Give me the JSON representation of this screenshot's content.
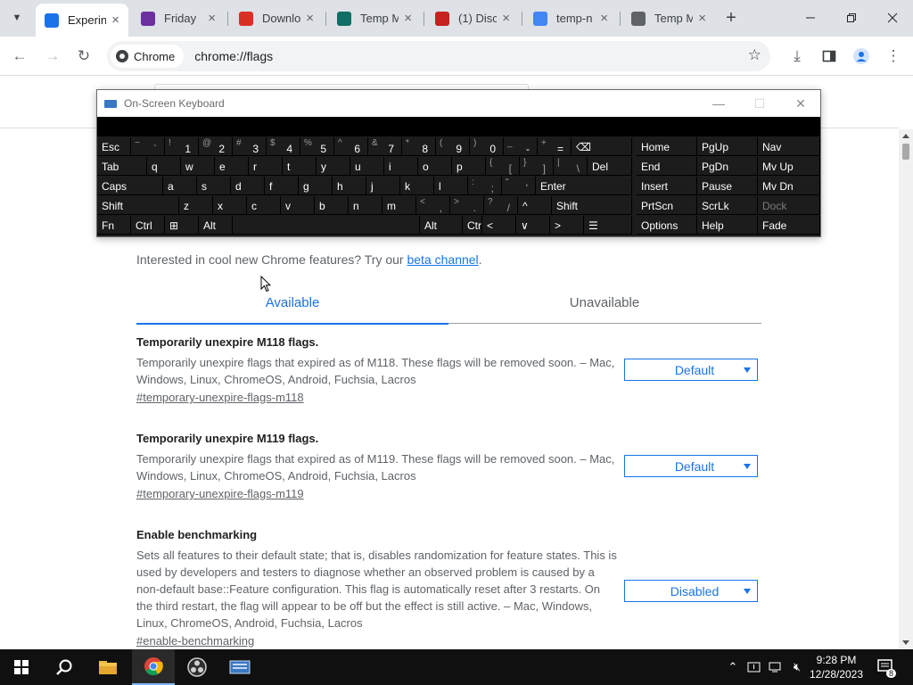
{
  "browser": {
    "tabs": [
      {
        "title": "Experin",
        "favicon_color": "#1a73e8",
        "active": true
      },
      {
        "title": "Friday",
        "favicon_color": "#6b2fa0",
        "active": false
      },
      {
        "title": "Downlo",
        "favicon_color": "#d93025",
        "active": false
      },
      {
        "title": "Temp M",
        "favicon_color": "#0f6e65",
        "active": false
      },
      {
        "title": "(1) Disc",
        "favicon_color": "#c5221f",
        "active": false
      },
      {
        "title": "temp-n",
        "favicon_color": "#4285f4",
        "active": false
      },
      {
        "title": "Temp M",
        "favicon_color": "#5f6368",
        "active": false
      }
    ],
    "chip_label": "Chrome",
    "url": "chrome://flags"
  },
  "page": {
    "promo_text": "Interested in cool new Chrome features? Try our ",
    "promo_link": "beta channel",
    "promo_end": ".",
    "tab_available": "Available",
    "tab_unavailable": "Unavailable",
    "flags": [
      {
        "title": "Temporarily unexpire M118 flags.",
        "description": "Temporarily unexpire flags that expired as of M118. These flags will be removed soon. – Mac, Windows, Linux, ChromeOS, Android, Fuchsia, Lacros",
        "permalink": "#temporary-unexpire-flags-m118",
        "value": "Default"
      },
      {
        "title": "Temporarily unexpire M119 flags.",
        "description": "Temporarily unexpire flags that expired as of M119. These flags will be removed soon. – Mac, Windows, Linux, ChromeOS, Android, Fuchsia, Lacros",
        "permalink": "#temporary-unexpire-flags-m119",
        "value": "Default"
      },
      {
        "title": "Enable benchmarking",
        "description": "Sets all features to their default state; that is, disables randomization for feature states. This is used by developers and testers to diagnose whether an observed problem is caused by a non-default base::Feature configuration. This flag is automatically reset after 3 restarts. On the third restart, the flag will appear to be off but the effect is still active. – Mac, Windows, Linux, ChromeOS, Android, Fuchsia, Lacros",
        "permalink": "#enable-benchmarking",
        "value": "Disabled"
      }
    ]
  },
  "osk": {
    "title": "On-Screen Keyboard",
    "row1": [
      {
        "lg": "Esc"
      },
      {
        "sm": "~",
        "lg": "`"
      },
      {
        "sm": "!",
        "lg": "1"
      },
      {
        "sm": "@",
        "lg": "2"
      },
      {
        "sm": "#",
        "lg": "3"
      },
      {
        "sm": "$",
        "lg": "4"
      },
      {
        "sm": "%",
        "lg": "5"
      },
      {
        "sm": "^",
        "lg": "6"
      },
      {
        "sm": "&",
        "lg": "7"
      },
      {
        "sm": "*",
        "lg": "8"
      },
      {
        "sm": "(",
        "lg": "9"
      },
      {
        "sm": ")",
        "lg": "0"
      },
      {
        "sm": "_",
        "lg": "-"
      },
      {
        "sm": "+",
        "lg": "="
      },
      {
        "lg": "⌫"
      }
    ],
    "row2": [
      {
        "lg": "Tab"
      },
      {
        "lg": "q"
      },
      {
        "lg": "w"
      },
      {
        "lg": "e"
      },
      {
        "lg": "r"
      },
      {
        "lg": "t"
      },
      {
        "lg": "y"
      },
      {
        "lg": "u"
      },
      {
        "lg": "i"
      },
      {
        "lg": "o"
      },
      {
        "lg": "p"
      },
      {
        "sm": "{",
        "lg": "["
      },
      {
        "sm": "}",
        "lg": "]"
      },
      {
        "sm": "|",
        "lg": "\\"
      },
      {
        "lg": "Del"
      }
    ],
    "row3": [
      {
        "lg": "Caps"
      },
      {
        "lg": "a"
      },
      {
        "lg": "s"
      },
      {
        "lg": "d"
      },
      {
        "lg": "f"
      },
      {
        "lg": "g"
      },
      {
        "lg": "h"
      },
      {
        "lg": "j"
      },
      {
        "lg": "k"
      },
      {
        "lg": "l"
      },
      {
        "sm": ":",
        "lg": ";"
      },
      {
        "sm": "\"",
        "lg": "'"
      },
      {
        "lg": "Enter"
      }
    ],
    "row4": [
      {
        "lg": "Shift"
      },
      {
        "lg": "z"
      },
      {
        "lg": "x"
      },
      {
        "lg": "c"
      },
      {
        "lg": "v"
      },
      {
        "lg": "b"
      },
      {
        "lg": "n"
      },
      {
        "lg": "m"
      },
      {
        "sm": "<",
        "lg": ","
      },
      {
        "sm": ">",
        "lg": "."
      },
      {
        "sm": "?",
        "lg": "/"
      },
      {
        "lg": "^"
      },
      {
        "lg": "Shift"
      }
    ],
    "row5": [
      {
        "lg": "Fn"
      },
      {
        "lg": "Ctrl"
      },
      {
        "lg": "⊞"
      },
      {
        "lg": "Alt"
      },
      {
        "lg": ""
      },
      {
        "lg": "Alt"
      },
      {
        "lg": "Ctrl"
      },
      {
        "lg": "<"
      },
      {
        "lg": "∨"
      },
      {
        "lg": ">"
      },
      {
        "lg": "☰"
      }
    ],
    "nav": [
      [
        "Home",
        "PgUp",
        "Nav"
      ],
      [
        "End",
        "PgDn",
        "Mv Up"
      ],
      [
        "Insert",
        "Pause",
        "Mv Dn"
      ],
      [
        "PrtScn",
        "ScrLk",
        "Dock"
      ],
      [
        "Options",
        "Help",
        "Fade"
      ]
    ]
  },
  "taskbar": {
    "time": "9:28 PM",
    "date": "12/28/2023",
    "notification_count": "8"
  }
}
